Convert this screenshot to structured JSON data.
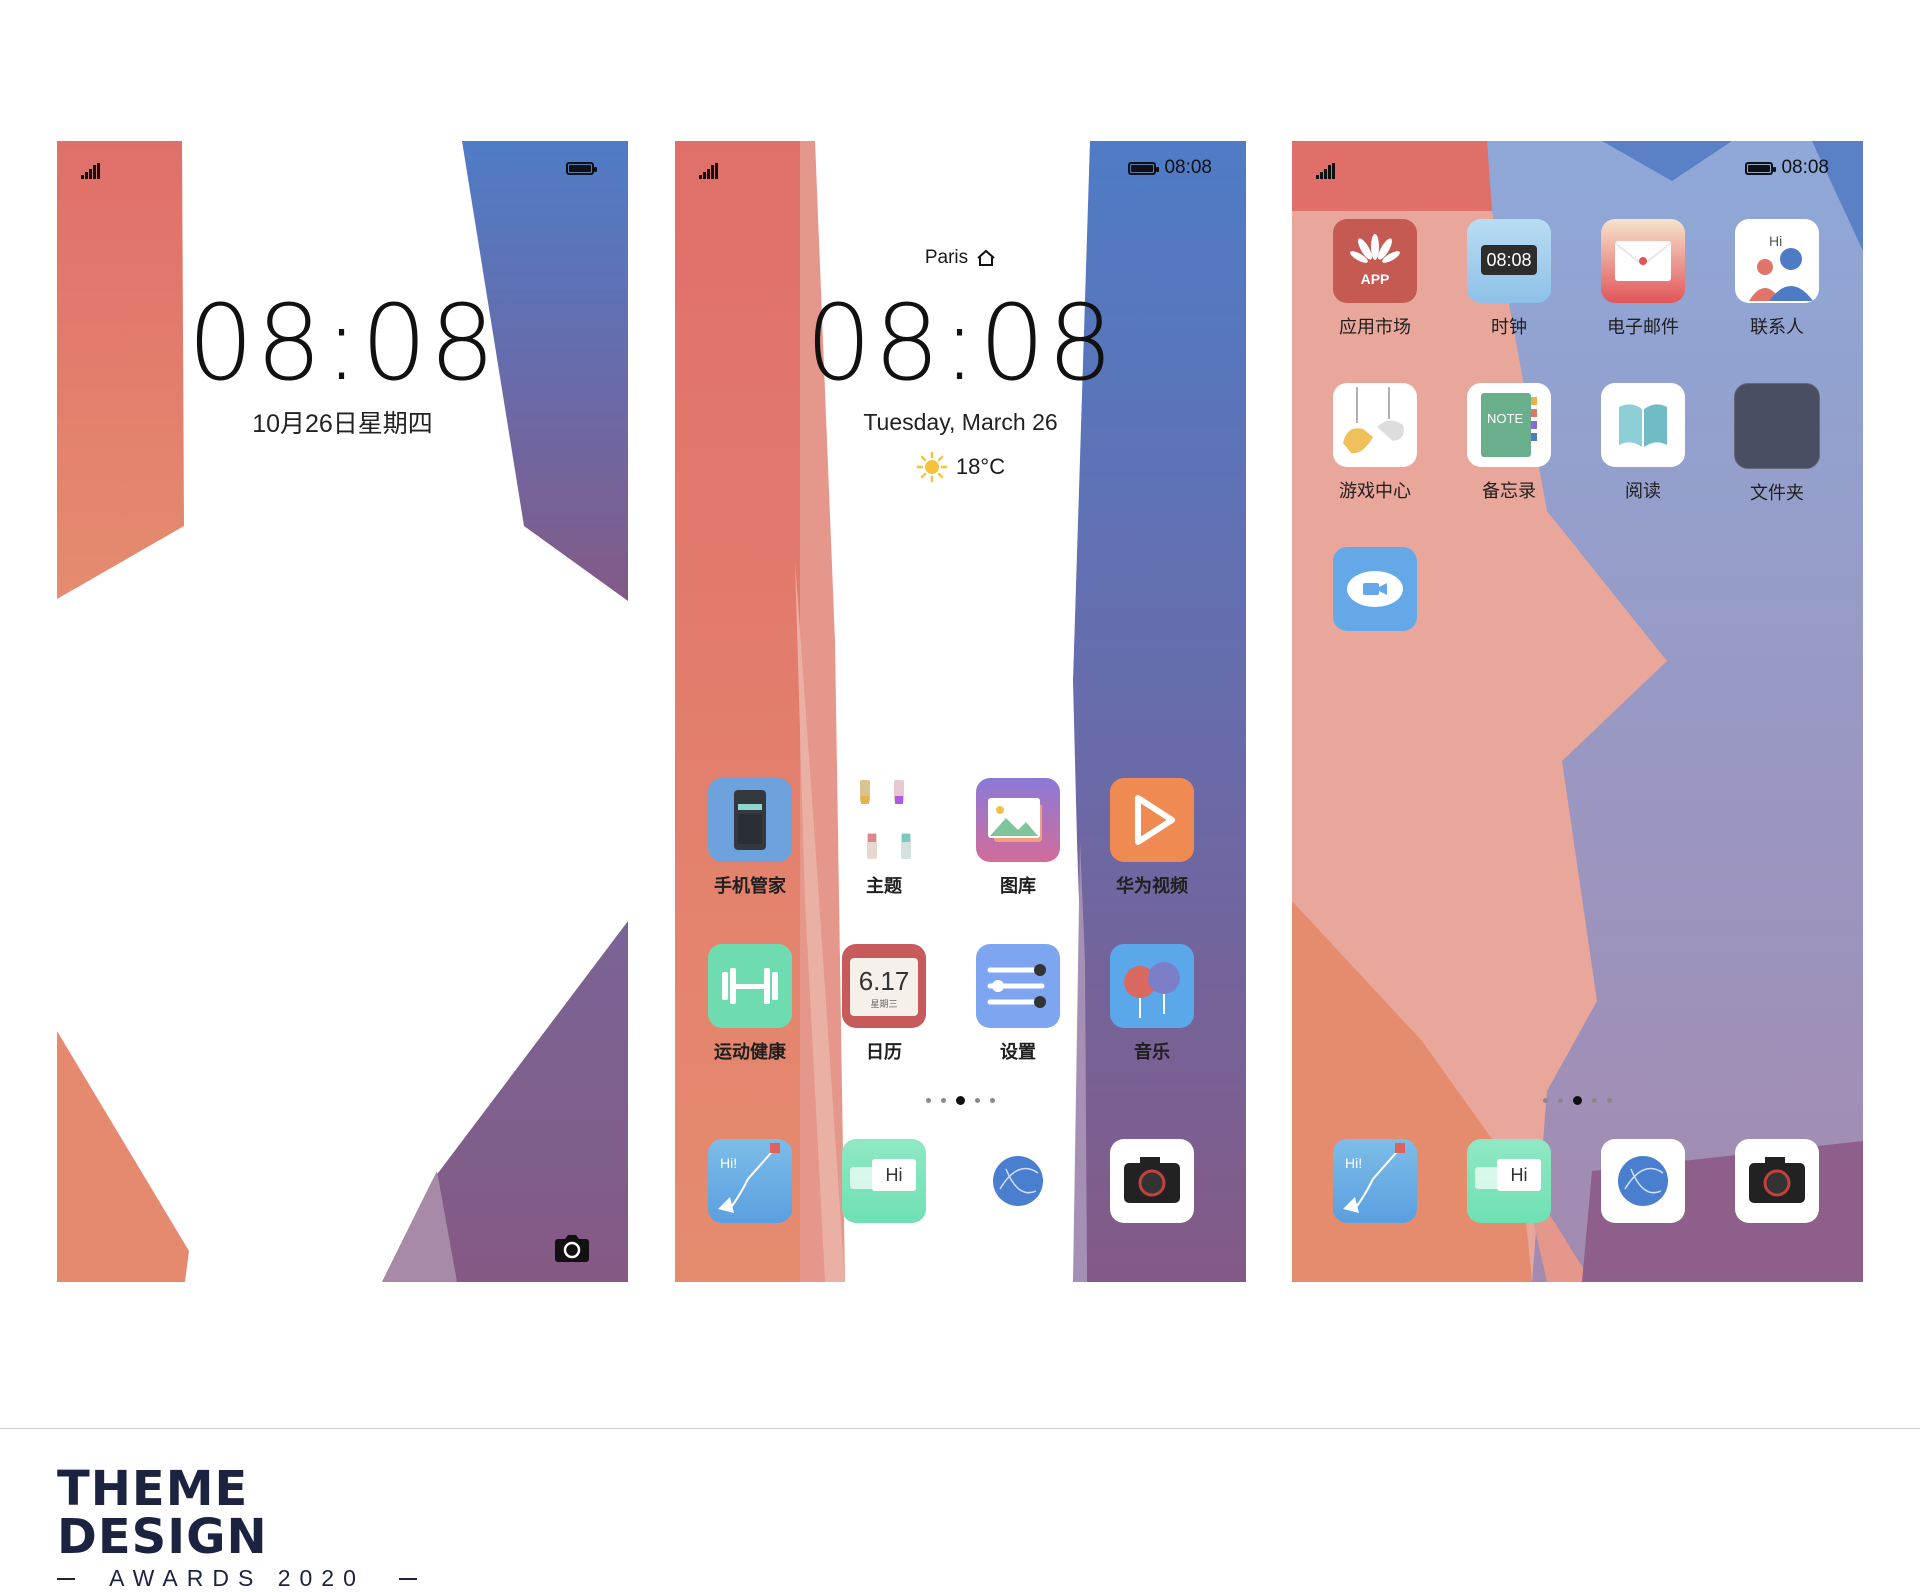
{
  "colors": {
    "coral": "#e07468",
    "peach": "#e58c70",
    "blue": "#4f7bc4",
    "purple": "#7b5a8c",
    "pink": "#eba89a"
  },
  "lock": {
    "time": "08:08",
    "date": "10月26日星期四",
    "camera_icon": "camera-icon"
  },
  "home": {
    "status_time": "08:08",
    "city": "Paris",
    "time": "08:08",
    "date": "Tuesday, March 26",
    "temperature": "18°C",
    "apps": [
      {
        "label": "手机管家",
        "icon": "phone-manager-icon"
      },
      {
        "label": "主题",
        "icon": "themes-icon"
      },
      {
        "label": "图库",
        "icon": "gallery-icon"
      },
      {
        "label": "华为视频",
        "icon": "video-icon"
      },
      {
        "label": "运动健康",
        "icon": "health-icon"
      },
      {
        "label": "日历",
        "icon": "calendar-icon",
        "date": "6.17",
        "weekday": "星期三"
      },
      {
        "label": "设置",
        "icon": "settings-icon"
      },
      {
        "label": "音乐",
        "icon": "music-icon"
      }
    ],
    "dock": [
      {
        "icon": "phone-icon",
        "text": "Hi!"
      },
      {
        "icon": "messages-icon",
        "text": "Hi"
      },
      {
        "icon": "browser-icon"
      },
      {
        "icon": "camera-icon"
      }
    ]
  },
  "apps_page": {
    "status_time": "08:08",
    "apps": [
      {
        "label": "应用市场",
        "icon": "app-market-icon",
        "text": "APP"
      },
      {
        "label": "时钟",
        "icon": "clock-icon",
        "text": "08:08"
      },
      {
        "label": "电子邮件",
        "icon": "email-icon"
      },
      {
        "label": "联系人",
        "icon": "contacts-icon",
        "text": "Hi"
      },
      {
        "label": "游戏中心",
        "icon": "game-center-icon"
      },
      {
        "label": "备忘录",
        "icon": "notes-icon",
        "text": "NOTE"
      },
      {
        "label": "阅读",
        "icon": "reading-icon"
      },
      {
        "label": "文件夹",
        "icon": "folder-icon"
      },
      {
        "label": "",
        "icon": "video-call-icon"
      }
    ],
    "dock": [
      {
        "icon": "phone-icon",
        "text": "Hi!"
      },
      {
        "icon": "messages-icon",
        "text": "Hi"
      },
      {
        "icon": "browser-icon"
      },
      {
        "icon": "camera-icon"
      }
    ]
  },
  "footer": {
    "title": "THEME DESIGN",
    "subtitle": "AWARDS 2020"
  }
}
